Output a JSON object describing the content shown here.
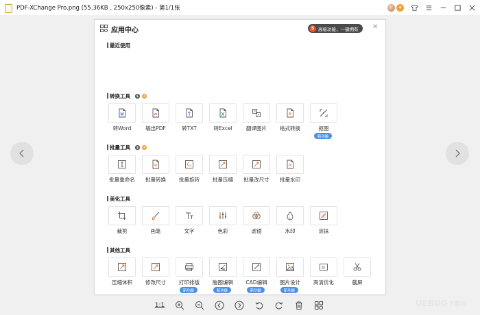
{
  "window": {
    "title": "PDF-XChange Pro.png (55.36KB , 250x250像素) - 第1/1张"
  },
  "panel": {
    "title": "应用中心",
    "promo_text": "高级功能，一键拥有",
    "promo_badge": "S",
    "close_icon": "close-icon"
  },
  "sections": {
    "recent": {
      "title": "最近使用"
    },
    "convert": {
      "title": "转换工具",
      "items": [
        {
          "label": "转Word",
          "icon": "word-doc-icon"
        },
        {
          "label": "输出PDF",
          "icon": "pdf-export-icon"
        },
        {
          "label": "转TXT",
          "icon": "txt-doc-icon"
        },
        {
          "label": "转Excel",
          "icon": "excel-doc-icon"
        },
        {
          "label": "翻译图片",
          "icon": "translate-icon"
        },
        {
          "label": "格式转换",
          "icon": "format-convert-icon"
        },
        {
          "label": "抠图",
          "icon": "cutout-icon",
          "badge": "新功能"
        }
      ]
    },
    "batch": {
      "title": "批量工具",
      "items": [
        {
          "label": "批量重命名",
          "icon": "batch-rename-icon"
        },
        {
          "label": "批量转换",
          "icon": "batch-convert-icon"
        },
        {
          "label": "批量旋转",
          "icon": "batch-rotate-icon"
        },
        {
          "label": "批量压缩",
          "icon": "batch-compress-icon"
        },
        {
          "label": "批量改尺寸",
          "icon": "batch-resize-icon"
        },
        {
          "label": "批量水印",
          "icon": "batch-watermark-icon"
        }
      ]
    },
    "beautify": {
      "title": "美化工具",
      "items": [
        {
          "label": "裁剪",
          "icon": "crop-icon"
        },
        {
          "label": "画笔",
          "icon": "brush-icon"
        },
        {
          "label": "文字",
          "icon": "text-icon"
        },
        {
          "label": "色彩",
          "icon": "color-adjust-icon"
        },
        {
          "label": "滤镜",
          "icon": "filter-icon"
        },
        {
          "label": "水印",
          "icon": "watermark-icon"
        },
        {
          "label": "涂抹",
          "icon": "smear-icon"
        }
      ]
    },
    "other": {
      "title": "其他工具",
      "items": [
        {
          "label": "压缩体积",
          "icon": "compress-icon"
        },
        {
          "label": "修改尺寸",
          "icon": "resize-icon"
        },
        {
          "label": "打印排版",
          "icon": "print-layout-icon",
          "badge": "新功能"
        },
        {
          "label": "脑图编辑",
          "icon": "mindmap-icon",
          "badge": "新功能"
        },
        {
          "label": "CAD编辑",
          "icon": "cad-edit-icon",
          "badge": "新功能"
        },
        {
          "label": "图片设计",
          "icon": "image-design-icon",
          "badge": "新功能"
        },
        {
          "label": "高清优化",
          "icon": "ai-enhance-icon"
        },
        {
          "label": "截屏",
          "icon": "screenshot-icon"
        }
      ]
    }
  },
  "toolbar": {
    "actual_size": "1:1"
  },
  "watermark": {
    "brand": "UEBUG",
    "suffix": "下载站"
  },
  "colors": {
    "accent_blue": "#4a90e2",
    "promo_bg": "#4a4a4a",
    "promo_badge": "#e2572c",
    "vip_orange": "#f0a23a"
  }
}
